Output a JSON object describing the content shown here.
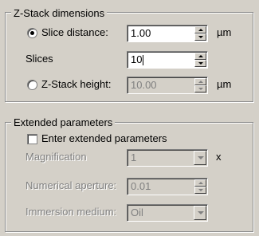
{
  "zstack": {
    "title": "Z-Stack dimensions",
    "slice_distance": {
      "label": "Slice distance:",
      "value": "1.00",
      "unit": "µm",
      "selected": true
    },
    "slices": {
      "label": "Slices",
      "value": "10"
    },
    "zstack_height": {
      "label": "Z-Stack height:",
      "value": "10.00",
      "unit": "µm",
      "selected": false
    }
  },
  "extended": {
    "title": "Extended parameters",
    "enter_checkbox": {
      "label": "Enter extended parameters",
      "checked": false
    },
    "magnification": {
      "label": "Magnification",
      "value": "1",
      "unit": "x"
    },
    "numerical_aperture": {
      "label": "Numerical aperture:",
      "value": "0.01"
    },
    "immersion_medium": {
      "label": "Immersion medium:",
      "value": "Oil"
    }
  }
}
